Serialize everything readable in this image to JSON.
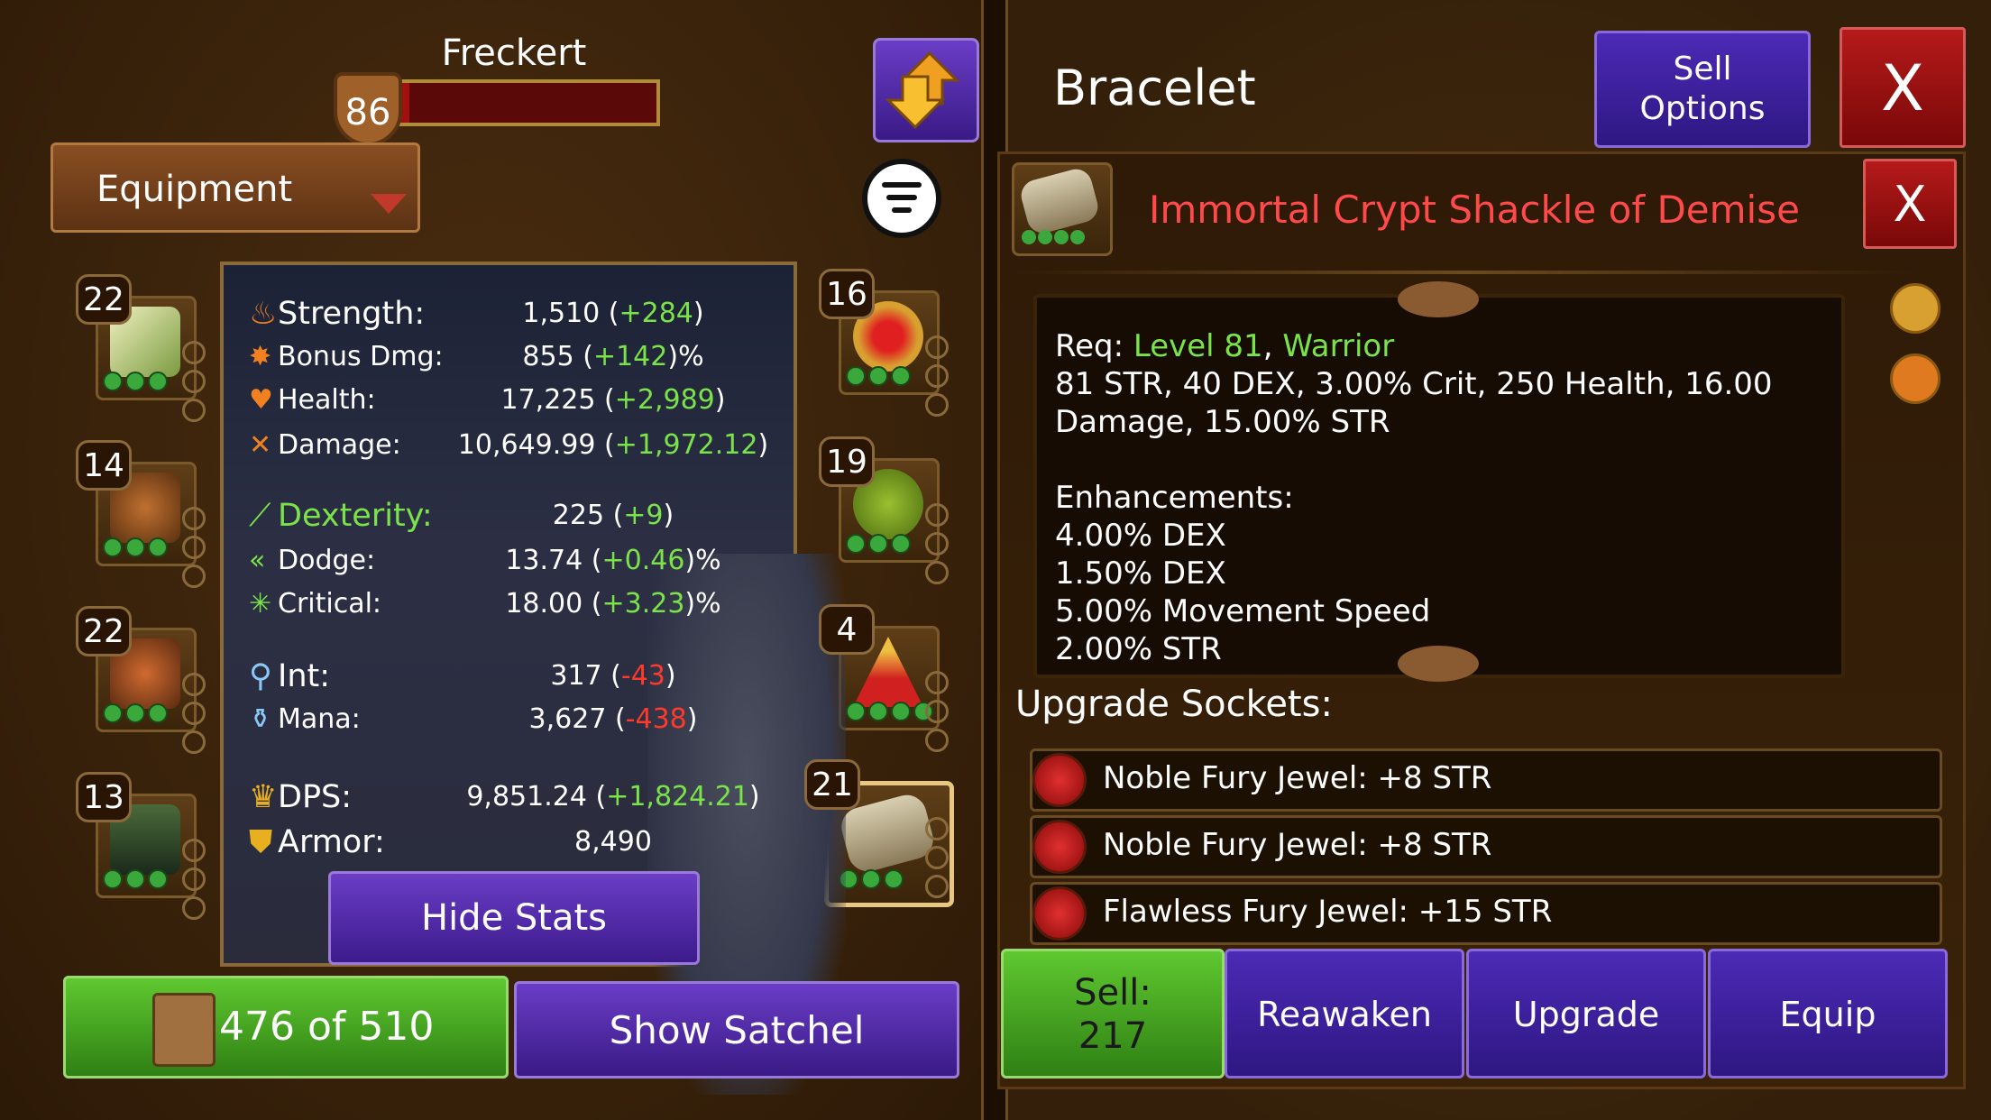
{
  "player": {
    "name": "Freckert",
    "level": "86",
    "xp_fraction": 0.05
  },
  "dropdown": {
    "label": "Equipment"
  },
  "left_slots": [
    {
      "level": "22",
      "item": "necklace"
    },
    {
      "level": "14",
      "item": "helmet"
    },
    {
      "level": "22",
      "item": "chest-armor"
    },
    {
      "level": "13",
      "item": "boots"
    }
  ],
  "right_slots": [
    {
      "level": "16",
      "item": "ring"
    },
    {
      "level": "19",
      "item": "offhand-ring"
    },
    {
      "level": "4",
      "item": "amulet"
    },
    {
      "level": "21",
      "item": "bracelet"
    }
  ],
  "stats": {
    "strength": {
      "label": "Strength:",
      "value": "1,510",
      "delta": "+284"
    },
    "bonus_dmg": {
      "label": "Bonus Dmg:",
      "value": "855",
      "delta": "+142",
      "suffix": "%"
    },
    "health": {
      "label": "Health:",
      "value": "17,225",
      "delta": "+2,989"
    },
    "damage": {
      "label": "Damage:",
      "value": "10,649.99",
      "delta": "+1,972.12"
    },
    "dexterity": {
      "label": "Dexterity:",
      "value": "225",
      "delta": "+9"
    },
    "dodge": {
      "label": "Dodge:",
      "value": "13.74",
      "delta": "+0.46",
      "suffix": "%"
    },
    "critical": {
      "label": "Critical:",
      "value": "18.00",
      "delta": "+3.23",
      "suffix": "%"
    },
    "int": {
      "label": "Int:",
      "value": "317",
      "delta": "-43"
    },
    "mana": {
      "label": "Mana:",
      "value": "3,627",
      "delta": "-438"
    },
    "dps": {
      "label": "DPS:",
      "value": "9,851.24",
      "delta": "+1,824.21"
    },
    "armor": {
      "label": "Armor:",
      "value": "8,490"
    }
  },
  "buttons": {
    "hide_stats": "Hide Stats",
    "inventory_count": "476 of 510",
    "show_satchel": "Show Satchel",
    "sell_options_line1": "Sell",
    "sell_options_line2": "Options",
    "close": "X",
    "sell_line1": "Sell:",
    "sell_line2": "217",
    "reawaken": "Reawaken",
    "upgrade": "Upgrade",
    "equip": "Equip"
  },
  "item": {
    "type": "Bracelet",
    "name": "Immortal Crypt Shackle of Demise",
    "req_prefix": "Req: ",
    "req_level": "Level 81",
    "req_sep": ", ",
    "req_class": "Warrior",
    "base_line1": "81 STR, 40 DEX, 3.00% Crit, 250 Health, 16.00",
    "base_line2": "Damage, 15.00% STR",
    "enh_title": "Enhancements:",
    "enhancements": [
      "4.00% DEX",
      "1.50% DEX",
      "5.00% Movement Speed",
      "2.00% STR"
    ]
  },
  "sockets": {
    "title": "Upgrade Sockets:",
    "items": [
      "Noble Fury Jewel: +8 STR",
      "Noble Fury Jewel: +8 STR",
      "Flawless Fury Jewel: +15 STR"
    ]
  },
  "colors": {
    "accent_purple": "#4c2ab6",
    "sell_green": "#5fc830",
    "close_red": "#b51a1a",
    "item_name_red": "#ff4a4a",
    "req_green": "#7be34a"
  }
}
